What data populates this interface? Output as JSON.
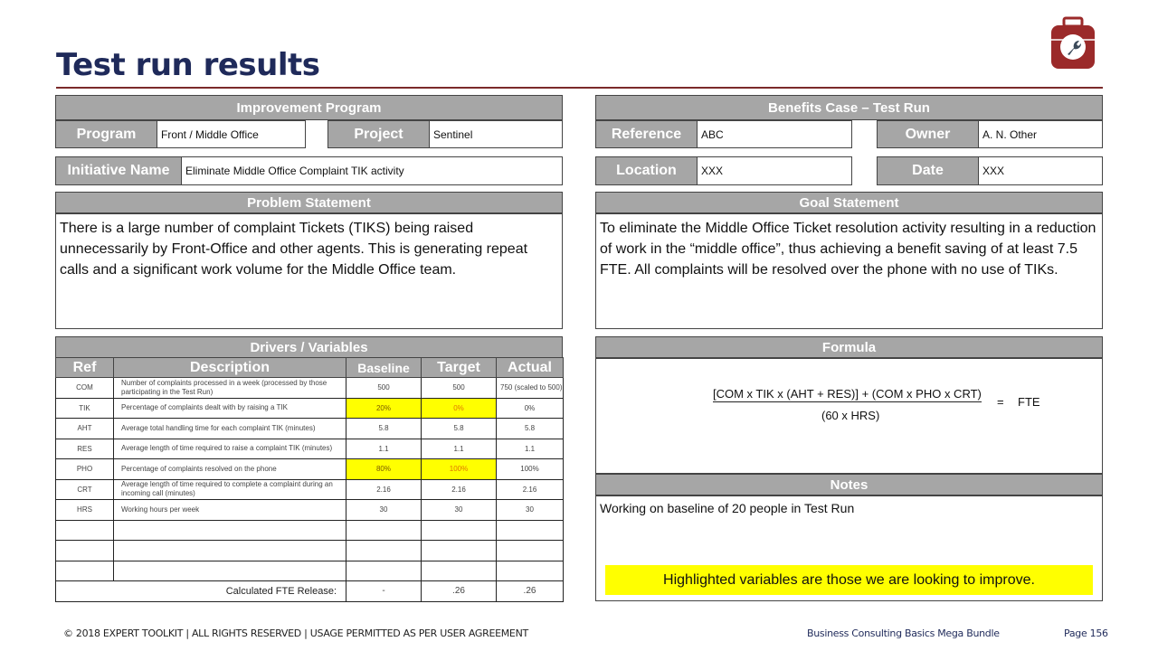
{
  "page": {
    "title": "Test run results"
  },
  "improvement_program": {
    "header": "Improvement Program",
    "program_label": "Program",
    "program_value": "Front / Middle Office",
    "project_label": "Project",
    "project_value": "Sentinel",
    "initiative_label": "Initiative Name",
    "initiative_value": "Eliminate Middle Office  Complaint  TIK activity"
  },
  "benefits_case": {
    "header": "Benefits Case – Test Run",
    "reference_label": "Reference",
    "reference_value": "ABC",
    "owner_label": "Owner",
    "owner_value": "A. N. Other",
    "location_label": "Location",
    "location_value": "XXX",
    "date_label": "Date",
    "date_value": "XXX"
  },
  "problem_statement": {
    "header": "Problem Statement",
    "text": "There is a large number of complaint Tickets (TIKS) being raised unnecessarily by Front-Office and other agents. This is generating repeat calls and a significant work volume for the Middle Office team."
  },
  "goal_statement": {
    "header": "Goal Statement",
    "text": "To eliminate the Middle Office Ticket resolution activity resulting in a reduction of work in the “middle office”, thus achieving a benefit saving of at least 7.5 FTE. All complaints will be resolved over the phone with no use of TIKs."
  },
  "drivers": {
    "header": "Drivers / Variables",
    "columns": [
      "Ref",
      "Description",
      "Baseline",
      "Target",
      "Actual"
    ],
    "rows": [
      {
        "ref": "COM",
        "description": "Number of complaints processed in a week (processed by those participating in the Test Run)",
        "baseline": "500",
        "target": "500",
        "actual": "750 (scaled to 500)"
      },
      {
        "ref": "TIK",
        "description": "Percentage of complaints dealt with by raising a TIK",
        "baseline": "20%",
        "target": "0%",
        "actual": "0%"
      },
      {
        "ref": "AHT",
        "description": "Average total handling time for each complaint TIK (minutes)",
        "baseline": "5.8",
        "target": "5.8",
        "actual": "5.8"
      },
      {
        "ref": "RES",
        "description": "Average length of time required to raise a complaint TIK (minutes)",
        "baseline": "1.1",
        "target": "1.1",
        "actual": "1.1"
      },
      {
        "ref": "PHO",
        "description": "Percentage of complaints resolved on the phone",
        "baseline": "80%",
        "target": "100%",
        "actual": "100%"
      },
      {
        "ref": "CRT",
        "description": "Average length of time required to complete a complaint during an incoming call (minutes)",
        "baseline": "2.16",
        "target": "2.16",
        "actual": "2.16"
      },
      {
        "ref": "HRS",
        "description": "Working hours per week",
        "baseline": "30",
        "target": "30",
        "actual": "30"
      }
    ],
    "calc_label": "Calculated FTE Release:",
    "calc_baseline": "-",
    "calc_target": ".26",
    "calc_actual": ".26"
  },
  "formula": {
    "header": "Formula",
    "numerator": "[COM x TIK x (AHT + RES)] + (COM x PHO x CRT)",
    "denominator": "(60 x HRS)",
    "equals": "=",
    "result": "FTE"
  },
  "notes": {
    "header": "Notes",
    "text": "Working on baseline of 20 people in Test Run",
    "highlight_text": "Highlighted variables are those we are looking to improve."
  },
  "footer": {
    "copyright": "© 2018 EXPERT TOOLKIT | ALL RIGHTS RESERVED | USAGE PERMITTED AS PER USER AGREEMENT",
    "bundle": "Business Consulting Basics Mega Bundle",
    "page": "Page 156"
  },
  "colors": {
    "title": "#1f2a5a",
    "header_gray": "#a6a6a6",
    "rule": "#7b2a2a",
    "highlight": "#ffff00",
    "logo_red": "#9b2a2a"
  }
}
